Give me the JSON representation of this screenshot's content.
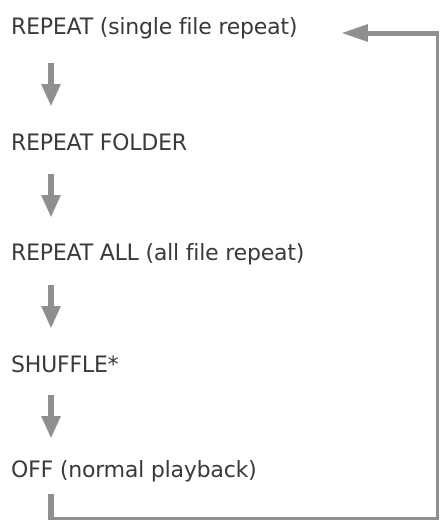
{
  "diagram": {
    "modes": [
      {
        "label": "REPEAT (single file repeat)"
      },
      {
        "label": "REPEAT FOLDER"
      },
      {
        "label": "REPEAT ALL (all file repeat)"
      },
      {
        "label": "SHUFFLE*"
      },
      {
        "label": "OFF (normal playback)"
      }
    ]
  },
  "colors": {
    "arrow": "#8f8f8f",
    "text": "#3a3a3a",
    "background": "#ffffff"
  }
}
